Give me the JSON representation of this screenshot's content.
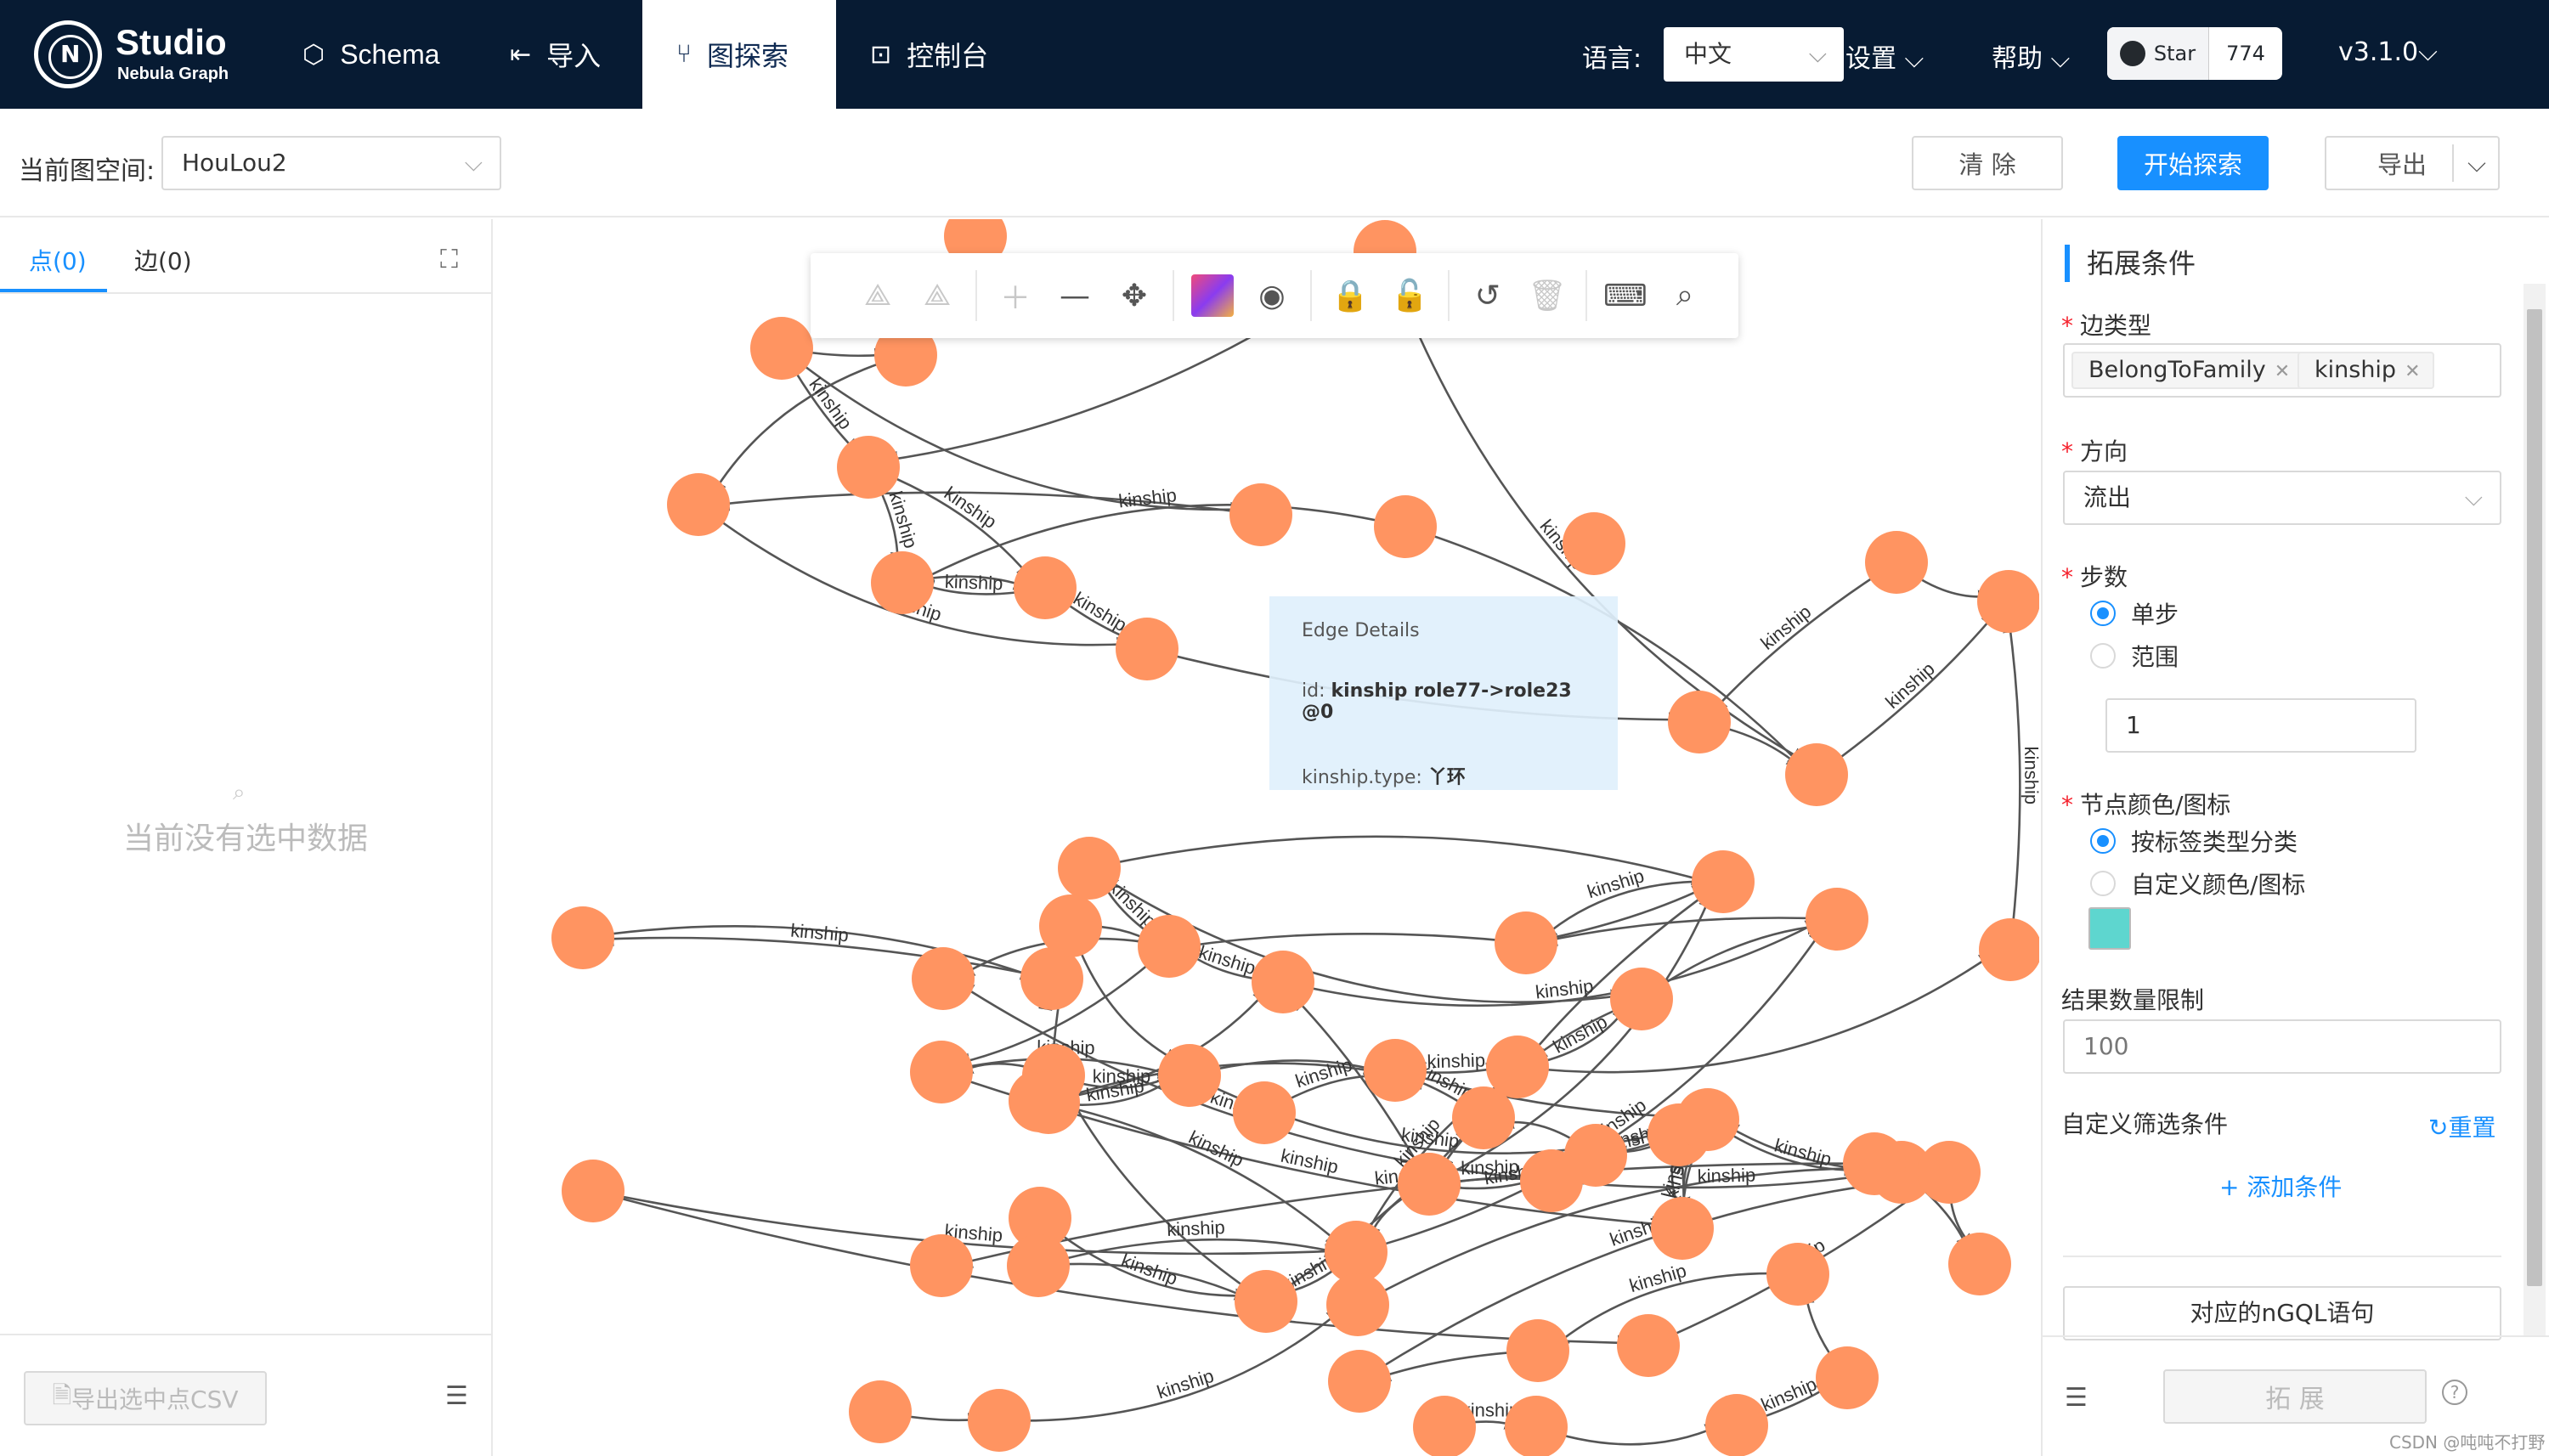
{
  "app": {
    "logo_title": "Studio",
    "logo_subtitle": "Nebula Graph",
    "logo_letter": "N",
    "nav": [
      {
        "label": "Schema",
        "icon": "schema-icon"
      },
      {
        "label": "导入",
        "icon": "import-icon"
      },
      {
        "label": "图探索",
        "icon": "explore-icon",
        "active": true
      },
      {
        "label": "控制台",
        "icon": "console-icon"
      }
    ],
    "lang_label": "语言:",
    "lang_value": "中文",
    "settings": "设置",
    "help": "帮助",
    "star_label": "Star",
    "star_count": "774",
    "version": "v3.1.0"
  },
  "subheader": {
    "space_label": "当前图空间:",
    "space_value": "HouLou2",
    "clear_btn": "清 除",
    "start_btn": "开始探索",
    "export_btn": "导出"
  },
  "left": {
    "tab_vertices": "点(0)",
    "tab_edges": "边(0)",
    "empty_text": "当前没有选中数据",
    "export_csv": "导出选中点CSV"
  },
  "tooltip": {
    "title": "Edge Details",
    "id_label": "id:",
    "id_value": "kinship role77->role23 @0",
    "type_label": "kinship.type:",
    "type_value": "丫环"
  },
  "right": {
    "title": "拓展条件",
    "edge_type_label": "边类型",
    "edge_tags": [
      "BelongToFamily",
      "kinship"
    ],
    "direction_label": "方向",
    "direction_value": "流出",
    "steps_label": "步数",
    "step_single": "单步",
    "step_range": "范围",
    "step_value": "1",
    "color_label": "节点颜色/图标",
    "color_by_tag": "按标签类型分类",
    "color_custom": "自定义颜色/图标",
    "custom_color": "#5ed6cf",
    "limit_label": "结果数量限制",
    "limit_value": "100",
    "filter_label": "自定义筛选条件",
    "reset": "重置",
    "add_condition": "+ 添加条件",
    "ngql_btn": "对应的nGQL语句",
    "expand_btn": "拓 展"
  },
  "graph": {
    "node_color": "#ff9461",
    "edge_label": "kinship"
  },
  "watermark": "CSDN @吨吨不打野"
}
